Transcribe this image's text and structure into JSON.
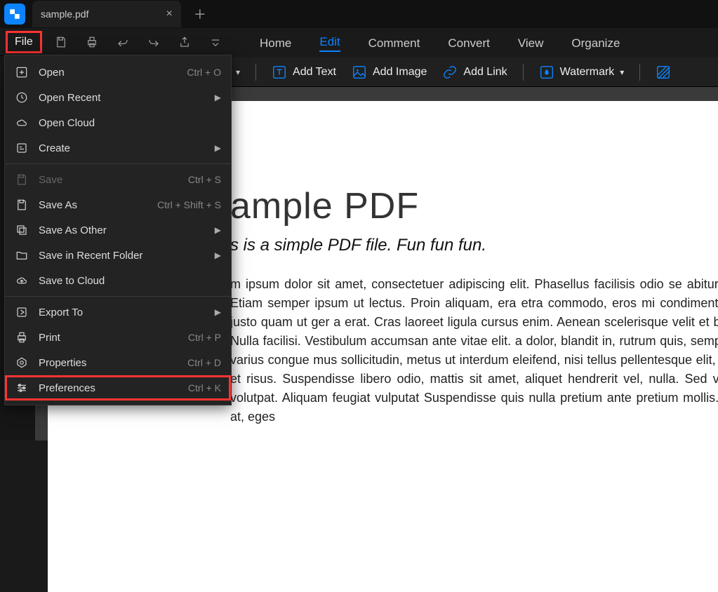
{
  "app": {
    "tab_title": "sample.pdf"
  },
  "quickbar": {
    "file_label": "File"
  },
  "menu": {
    "items": [
      "Home",
      "Edit",
      "Comment",
      "Convert",
      "View",
      "Organize"
    ],
    "active_index": 1
  },
  "toolbar": {
    "add_text": "Add Text",
    "add_image": "Add Image",
    "add_link": "Add Link",
    "watermark": "Watermark"
  },
  "file_menu": {
    "open": "Open",
    "open_hint": "Ctrl + O",
    "open_recent": "Open Recent",
    "open_cloud": "Open Cloud",
    "create": "Create",
    "save": "Save",
    "save_hint": "Ctrl + S",
    "save_as": "Save As",
    "save_as_hint": "Ctrl + Shift + S",
    "save_as_other": "Save As Other",
    "save_recent_folder": "Save in Recent Folder",
    "save_cloud": "Save to Cloud",
    "export_to": "Export To",
    "print": "Print",
    "print_hint": "Ctrl + P",
    "properties": "Properties",
    "properties_hint": "Ctrl + D",
    "preferences": "Preferences",
    "preferences_hint": "Ctrl + K"
  },
  "doc": {
    "title": "ample PDF",
    "subtitle": "s is a simple PDF file. Fun fun fun.",
    "body": "m ipsum dolor sit amet, consectetuer adipiscing elit. Phasellus facilisis odio se abitur suscipit. Nullam vel nisi. Etiam semper ipsum ut lectus. Proin aliquam, era etra commodo, eros mi condimentum quam, sed commodo justo quam ut ger a erat. Cras laoreet ligula cursus enim. Aenean scelerisque velit et bulum dictum aliquet sem. Nulla facilisi. Vestibulum accumsan ante vitae elit. a dolor, blandit in, rutrum quis, semper pulvinar, enim. Nullam varius congue mus sollicitudin, metus ut interdum eleifend, nisi tellus pellentesque elit, tris accumsan eros quam et risus. Suspendisse libero odio, mattis sit amet, aliquet hendrerit vel, nulla. Sed vitae augue. Aliquam erat volutpat. Aliquam feugiat vulputat Suspendisse quis nulla pretium ante pretium mollis. Proin velit ligula, sagittis at, eges"
  }
}
